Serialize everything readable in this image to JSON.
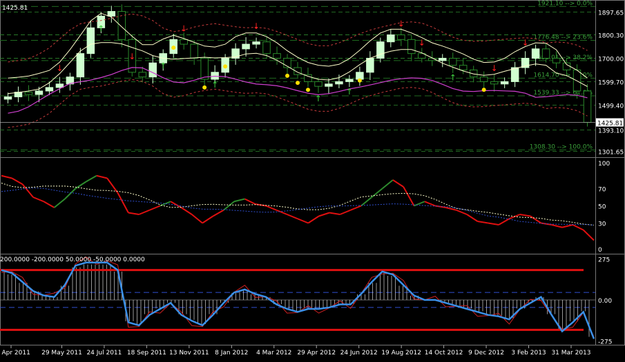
{
  "symbol_price": "1425.81",
  "price_labels": [
    "1897.65",
    "1800.30",
    "1700.00",
    "1599.70",
    "1499.40",
    "1393.10",
    "1301.65"
  ],
  "current_price_tag": "1425.81",
  "fib_levels": [
    {
      "label": "1921.10 --> 0.0%",
      "price": 1921.1
    },
    {
      "label": "1776.48 --> 23.6%",
      "price": 1776.48
    },
    {
      "label": "1690.01 --> 38.2%",
      "price": 1690.01
    },
    {
      "label": "1614.70 --> 50.0%",
      "price": 1614.7
    },
    {
      "label": "1539.33 --> 61.8%",
      "price": 1539.33
    },
    {
      "label": "1308.30 --> 100.0%",
      "price": 1308.3
    }
  ],
  "rsi_labels": [
    "100",
    "70",
    "50",
    "30",
    "0"
  ],
  "cci_header": "200.0000 -200.0000 50.0000 -50.0000 0.0000",
  "cci_labels": [
    "275",
    "0.00",
    "-275"
  ],
  "date_labels": [
    "17 Apr 2011",
    "29 May 2011",
    "24 Jul 2011",
    "18 Sep 2011",
    "13 Nov 2011",
    "8 Jan 2012",
    "4 Mar 2012",
    "29 Apr 2012",
    "24 Jun 2012",
    "19 Aug 2012",
    "14 Oct 2012",
    "9 Dec 2012",
    "3 Feb 2013",
    "31 Mar 2013"
  ],
  "colors": {
    "background": "#000000",
    "grid": "#2e8b2e",
    "candle_up": "#cfffcf",
    "candle_down": "#2a8a2a",
    "bollinger_upper": "#ffffcc",
    "envelope": "#c83c3c",
    "ma_magenta": "#d040d0",
    "rsi_up": "#2e8b2e",
    "rsi_down": "#e01010",
    "rsi_signal": "#ffffcc",
    "rsi_slow": "#3050d0",
    "cci_main": "#3a90e8",
    "cci_fast": "#d02020",
    "cci_band": "#e01010"
  },
  "chart_data": [
    {
      "type": "candlestick",
      "name": "",
      "ylim": [
        1280,
        1940
      ],
      "x_dates": [
        "17 Apr 2011",
        "29 May 2011",
        "24 Jul 2011",
        "18 Sep 2011",
        "13 Nov 2011",
        "8 Jan 2012",
        "4 Mar 2012",
        "29 Apr 2012",
        "24 Jun 2012",
        "19 Aug 2012",
        "14 Oct 2012",
        "9 Dec 2012",
        "3 Feb 2013",
        "31 Mar 2013"
      ],
      "close_series": [
        1535,
        1555,
        1545,
        1560,
        1575,
        1590,
        1620,
        1720,
        1830,
        1880,
        1900,
        1780,
        1640,
        1620,
        1680,
        1720,
        1780,
        1760,
        1700,
        1610,
        1640,
        1700,
        1740,
        1760,
        1770,
        1720,
        1700,
        1660,
        1630,
        1600,
        1580,
        1590,
        1600,
        1610,
        1640,
        1700,
        1770,
        1800,
        1780,
        1720,
        1700,
        1690,
        1700,
        1670,
        1650,
        1620,
        1600,
        1590,
        1600,
        1660,
        1700,
        1740,
        1700,
        1680,
        1650,
        1560,
        1426
      ],
      "last_close": 1425.81
    },
    {
      "type": "line",
      "name": "",
      "ylim": [
        0,
        100
      ],
      "y_ticks": [
        100,
        70,
        50,
        30,
        0
      ],
      "series": [
        {
          "values": [
            85,
            82,
            75,
            60,
            55,
            48,
            58,
            70,
            78,
            85,
            82,
            65,
            42,
            40,
            45,
            50,
            55,
            48,
            40,
            30,
            38,
            45,
            55,
            58,
            52,
            50,
            45,
            40,
            35,
            30,
            38,
            42,
            40,
            45,
            50,
            60,
            70,
            80,
            72,
            50,
            55,
            50,
            48,
            45,
            40,
            32,
            30,
            28,
            35,
            40,
            38,
            30,
            28,
            25,
            28,
            22,
            10
          ]
        }
      ]
    },
    {
      "type": "line",
      "name": "",
      "ylim": [
        -300,
        300
      ],
      "y_ticks": [
        275,
        0,
        -275
      ],
      "series": [
        {
          "values": [
            200,
            180,
            120,
            60,
            30,
            20,
            100,
            230,
            250,
            250,
            250,
            200,
            -150,
            -170,
            -100,
            -60,
            -20,
            -100,
            -140,
            -170,
            -100,
            -20,
            50,
            70,
            40,
            20,
            -30,
            -60,
            -80,
            -60,
            -60,
            -50,
            -30,
            -30,
            40,
            120,
            190,
            170,
            100,
            30,
            0,
            0,
            -20,
            -40,
            -60,
            -80,
            -100,
            -110,
            -130,
            -60,
            -20,
            20,
            -100,
            -210,
            -150,
            -80,
            -260
          ]
        }
      ]
    }
  ]
}
